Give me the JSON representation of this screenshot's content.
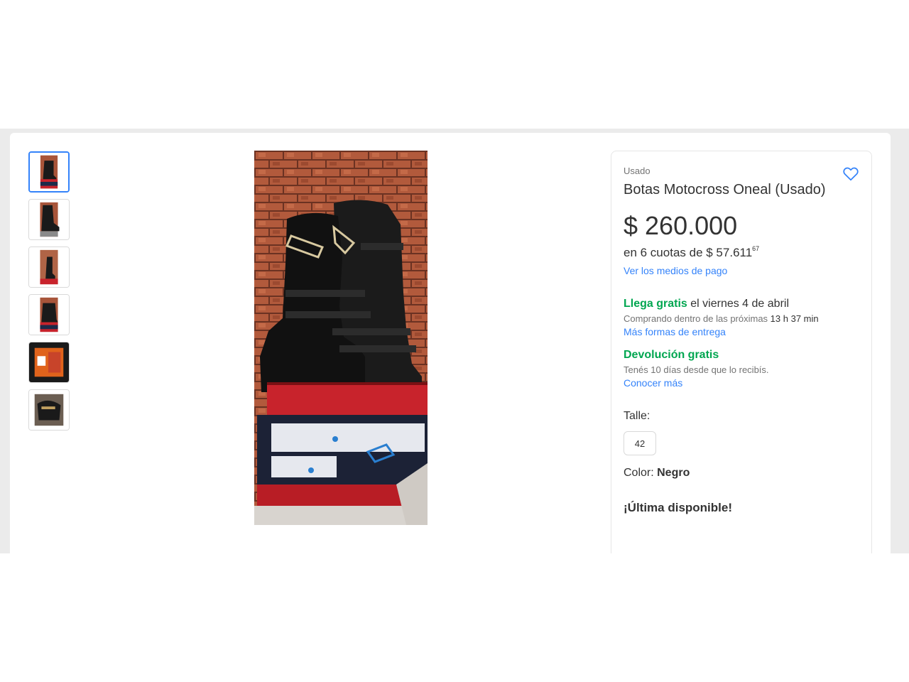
{
  "product": {
    "condition": "Usado",
    "title": "Botas Motocross Oneal (Usado)",
    "price": "$ 260.000",
    "installments_prefix": "en 6 cuotas de $ 57.611",
    "installments_cents": "67",
    "payment_link": "Ver los medios de pago"
  },
  "shipping": {
    "highlight": "Llega gratis",
    "date": " el viernes 4 de abril",
    "countdown_prefix": "Comprando dentro de las próximas ",
    "countdown_value": "13 h 37 min",
    "more_link": "Más formas de entrega"
  },
  "returns": {
    "title": "Devolución gratis",
    "detail": "Tenés 10 días desde que lo recibís.",
    "link": "Conocer más"
  },
  "variations": {
    "size_label": "Talle:",
    "size_value": "42",
    "color_label": "Color: ",
    "color_value": "Negro"
  },
  "stock": {
    "message": "¡Última disponible!"
  },
  "gallery": {
    "thumbnails": [
      "boots-front",
      "boots-side",
      "boot-single",
      "boots-box",
      "size-label",
      "boots-top"
    ],
    "active_index": 0
  },
  "icons": {
    "favorite": "heart-icon"
  },
  "colors": {
    "accent": "#3483fa",
    "success": "#00a650"
  }
}
